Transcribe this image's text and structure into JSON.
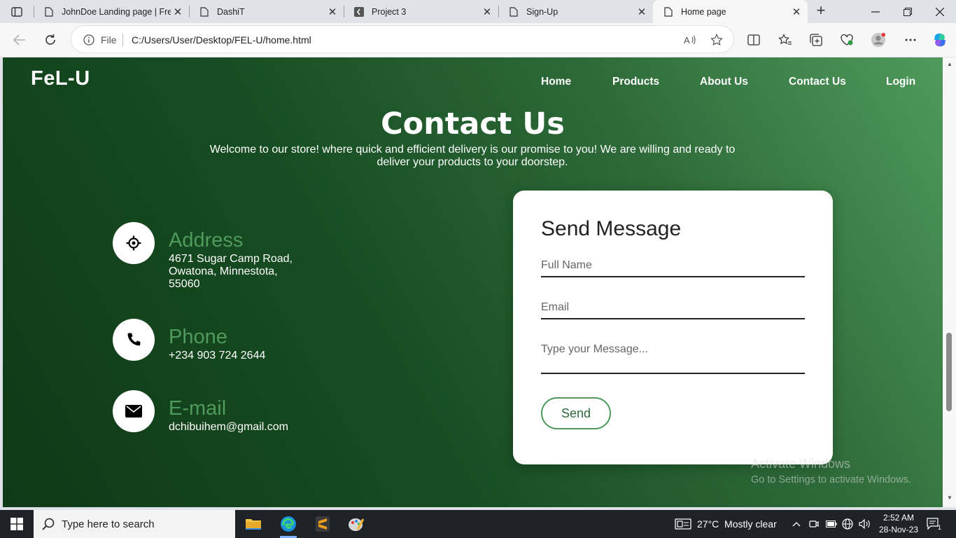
{
  "browser": {
    "tabs": [
      {
        "title": "JohnDoe Landing page | Free",
        "icon": "page-icon"
      },
      {
        "title": "DashiT",
        "icon": "page-icon"
      },
      {
        "title": "Project 3",
        "icon": "project-icon"
      },
      {
        "title": "Sign-Up",
        "icon": "page-icon"
      },
      {
        "title": "Home page",
        "icon": "page-icon"
      }
    ],
    "address": {
      "scheme_label": "File",
      "url": "C:/Users/User/Desktop/FEL-U/home.html"
    }
  },
  "site": {
    "brand": "FeL-U",
    "nav": [
      "Home",
      "Products",
      "About Us",
      "Contact Us",
      "Login"
    ],
    "heading": "Contact Us",
    "intro": "Welcome to our store! where quick and efficient delivery is our promise to you! We are willing and ready to deliver your products to your doorstep.",
    "contacts": [
      {
        "title": "Address",
        "lines": [
          "4671 Sugar Camp Road,",
          "Owatona, Minnestota,",
          "55060"
        ],
        "icon": "location-icon"
      },
      {
        "title": "Phone",
        "lines": [
          "+234 903 724 2644"
        ],
        "icon": "phone-icon"
      },
      {
        "title": "E-mail",
        "lines": [
          "dchibuihem@gmail.com"
        ],
        "icon": "envelope-icon"
      }
    ],
    "form": {
      "title": "Send Message",
      "full_name_placeholder": "Full Name",
      "email_placeholder": "Email",
      "message_placeholder": "Type your Message...",
      "send_label": "Send"
    },
    "colors": {
      "accent": "#4f9a5c",
      "bg_dark": "#0f3a17"
    }
  },
  "watermark": {
    "line1": "Activate Windows",
    "line2": "Go to Settings to activate Windows."
  },
  "taskbar": {
    "search_placeholder": "Type here to search",
    "weather": "27°C  Mostly clear",
    "time": "2:52 AM",
    "date": "28-Nov-23",
    "notifications": "1"
  }
}
